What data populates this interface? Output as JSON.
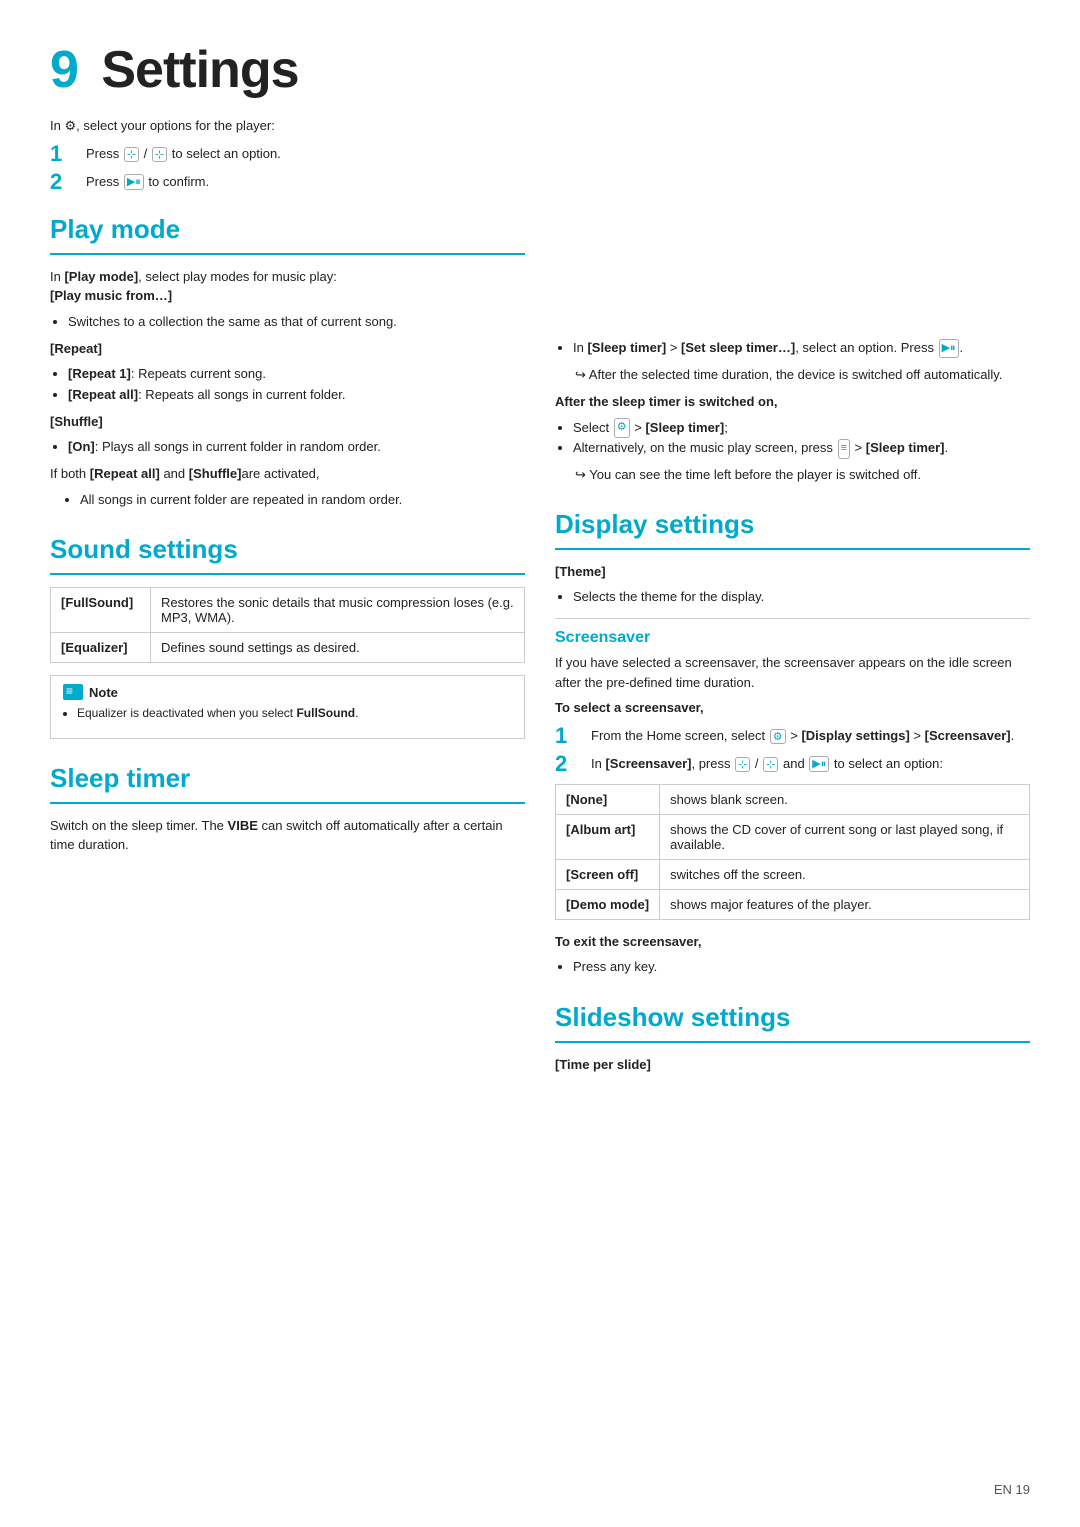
{
  "page": {
    "chapter": "9",
    "title": "Settings",
    "footer": "EN    19"
  },
  "intro": {
    "text": "In ⚙, select your options for the player:",
    "steps": [
      {
        "num": "1",
        "text": "Press ⊹ / ⊹ to select an option."
      },
      {
        "num": "2",
        "text": "Press ▶⏸ to confirm."
      }
    ]
  },
  "sections": {
    "play_mode": {
      "title": "Play mode",
      "intro": "In [Play mode], select play modes for music play:",
      "subsections": [
        {
          "term": "[Play music from…]",
          "bullets": [
            "Switches to a collection the same as that of current song."
          ]
        },
        {
          "term": "[Repeat]",
          "bullets": [
            "[Repeat 1]: Repeats current song.",
            "[Repeat all]: Repeats all songs in current folder."
          ]
        },
        {
          "term": "[Shuffle]",
          "bullets": [
            "[On]: Plays all songs in current folder in random order."
          ]
        }
      ],
      "extra": "If both [Repeat all] and [Shuffle]are activated,",
      "extra_bullets": [
        "All songs in current folder are repeated in random order."
      ]
    },
    "sound_settings": {
      "title": "Sound settings",
      "table": [
        {
          "term": "[FullSound]",
          "def": "Restores the sonic details that music compression loses (e.g. MP3, WMA)."
        },
        {
          "term": "[Equalizer]",
          "def": "Defines sound settings as desired."
        }
      ],
      "note": {
        "label": "Note",
        "bullets": [
          "Equalizer is deactivated when you select FullSound."
        ]
      }
    },
    "sleep_timer": {
      "title": "Sleep timer",
      "intro": "Switch on the sleep timer. The VIBE can switch off automatically after a certain time duration.",
      "bullet_main": "In [Sleep timer] > [Set sleep timer…], select an option. Press ▶⏸.",
      "arrow_note": "After the selected time duration, the device is switched off automatically.",
      "after_on_title": "After the sleep timer is switched on,",
      "after_on_bullets": [
        "Select ⚙ > [Sleep timer];",
        "Alternatively, on the music play screen, press ≡ > [Sleep timer]."
      ],
      "arrow_note2": "You can see the time left before the player is switched off."
    },
    "display_settings": {
      "title": "Display settings",
      "theme": {
        "term": "[Theme]",
        "def": "Selects the theme for the display."
      },
      "screensaver": {
        "subtitle": "Screensaver",
        "intro": "If you have selected a screensaver, the screensaver appears on the idle screen after the pre-defined time duration.",
        "steps_title": "To select a screensaver,",
        "steps": [
          {
            "num": "1",
            "text": "From the Home screen, select ⚙ > [Display settings] > [Screensaver]."
          },
          {
            "num": "2",
            "text": "In [Screensaver], press ⊹ / ⊹ and ▶⏸ to select an option:"
          }
        ],
        "table": [
          {
            "term": "[None]",
            "def": "shows blank screen."
          },
          {
            "term": "[Album art]",
            "def": "shows the CD cover of current song or last played song, if available."
          },
          {
            "term": "[Screen off]",
            "def": "switches off the screen."
          },
          {
            "term": "[Demo mode]",
            "def": "shows major features of the player."
          }
        ],
        "exit_title": "To exit the screensaver,",
        "exit_bullets": [
          "Press any key."
        ]
      }
    },
    "slideshow_settings": {
      "title": "Slideshow settings",
      "term": "[Time per slide]"
    }
  }
}
